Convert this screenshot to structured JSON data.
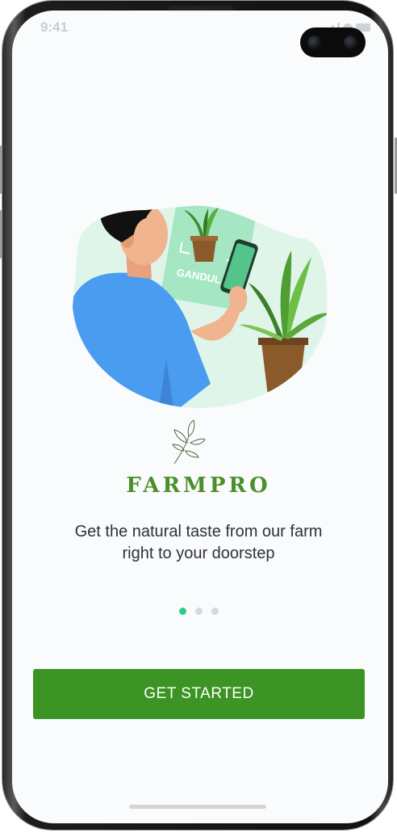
{
  "status_bar": {
    "time": "9:41",
    "icons": [
      "signal-icon",
      "wifi-icon",
      "battery-icon"
    ]
  },
  "illustration": {
    "card_label": "GANDUL"
  },
  "brand": {
    "name": "FARMPRO",
    "color": "#4b8f2a"
  },
  "tagline": {
    "line1": "Get the natural taste from our farm",
    "line2": "right to your doorstep"
  },
  "pagination": {
    "total": 3,
    "active_index": 0,
    "active_color": "#2ecc8a"
  },
  "cta": {
    "label": "GET STARTED",
    "color": "#3b9424"
  }
}
